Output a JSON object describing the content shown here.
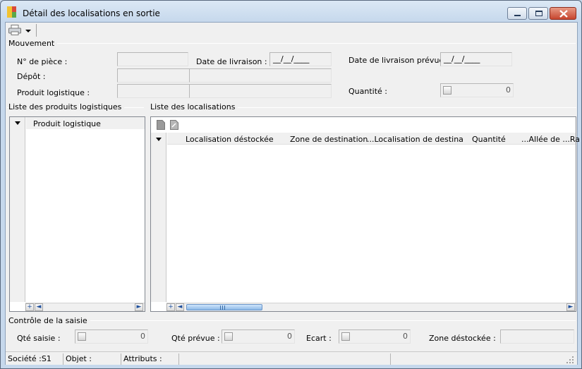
{
  "window": {
    "title": "Détail des localisations en sortie",
    "controls": {
      "minimize": "minimize",
      "maximize": "maximize",
      "close": "close"
    }
  },
  "toolbar": {
    "print_icon": "printer-icon",
    "dropdown_icon": "chevron-down-icon"
  },
  "mouvement": {
    "section_title": "Mouvement",
    "n_piece_label": "N° de pièce :",
    "n_piece_value": "",
    "date_livraison_label": "Date de livraison :",
    "date_livraison_value": "__/__/____",
    "date_livraison_prevue_label": "Date de livraison prévue :",
    "date_livraison_prevue_value": "__/__/____",
    "depot_label": "Dépôt :",
    "depot_code": "",
    "depot_name": "",
    "produit_label": "Produit logistique :",
    "produit_code": "",
    "produit_name": "",
    "quantite_label": "Quantité :",
    "quantite_value": "0"
  },
  "produits_panel": {
    "section_title": "Liste des produits logistiques",
    "column_header": "Produit logistique",
    "add_glyph": "+",
    "left_glyph": "◄",
    "right_glyph": "►"
  },
  "localisations_panel": {
    "section_title": "Liste des localisations",
    "columns": [
      "Localisation déstockée",
      "Zone de destination",
      "...Localisation de destina",
      "Quantité",
      "...Allée de ...Ra"
    ],
    "add_glyph": "+",
    "left_glyph": "◄",
    "right_glyph": "►"
  },
  "controle": {
    "section_title": "Contrôle de la saisie",
    "qte_saisie_label": "Qté saisie :",
    "qte_saisie_value": "0",
    "qte_prevue_label": "Qté prévue :",
    "qte_prevue_value": "0",
    "ecart_label": "Ecart :",
    "ecart_value": "0",
    "zone_destockee_label": "Zone déstockée :",
    "zone_destockee_value": ""
  },
  "statusbar": {
    "societe": "Société :S1",
    "objet": "Objet :",
    "attributs": "Attributs :"
  },
  "colors": {
    "window_bg": "#f0f0f0",
    "title_gradient_top": "#dbe8f5",
    "close_button": "#c7462f",
    "scroll_thumb": "#8cb8e6"
  }
}
